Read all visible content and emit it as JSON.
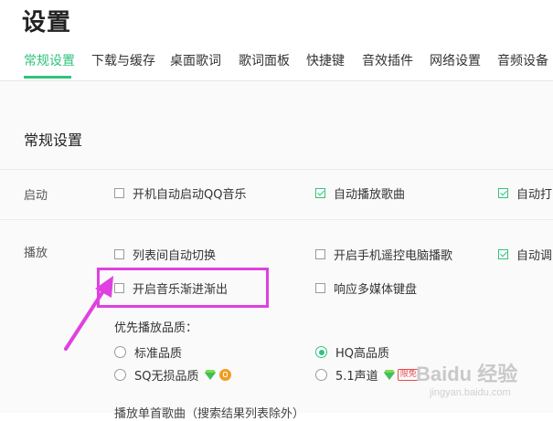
{
  "page": {
    "title": "设置"
  },
  "tabs": [
    {
      "label": "常规设置",
      "active": true
    },
    {
      "label": "下载与缓存"
    },
    {
      "label": "桌面歌词"
    },
    {
      "label": "歌词面板"
    },
    {
      "label": "快捷键"
    },
    {
      "label": "音效插件"
    },
    {
      "label": "网络设置"
    },
    {
      "label": "音频设备"
    }
  ],
  "section": {
    "title": "常规设置"
  },
  "startup": {
    "label": "启动",
    "options": [
      {
        "label": "开机自动启动QQ音乐",
        "checked": false
      },
      {
        "label": "自动播放歌曲",
        "checked": true
      },
      {
        "label": "自动打",
        "checked": true
      }
    ]
  },
  "playback": {
    "label": "播放",
    "options": [
      {
        "label": "列表间自动切换",
        "checked": false
      },
      {
        "label": "开启手机遥控电脑播歌",
        "checked": false
      },
      {
        "label": "自动调",
        "checked": true
      },
      {
        "label": "开启音乐渐进渐出",
        "checked": false
      },
      {
        "label": "响应多媒体键盘",
        "checked": false
      }
    ],
    "quality": {
      "title": "优先播放品质：",
      "options": [
        {
          "label": "标准品质",
          "selected": false
        },
        {
          "label": "HQ高品质",
          "selected": true
        },
        {
          "label": "SQ无损品质",
          "selected": false
        },
        {
          "label": "5.1声道",
          "selected": false
        }
      ],
      "badge_limited": "限免"
    },
    "cut_text": "播放单首歌曲（搜索结果列表除外）"
  },
  "colors": {
    "accent": "#31c27c",
    "highlight": "#e040e0"
  },
  "watermark": {
    "text": "Baidu 经验",
    "sub": "jingyan.baidu.com"
  }
}
